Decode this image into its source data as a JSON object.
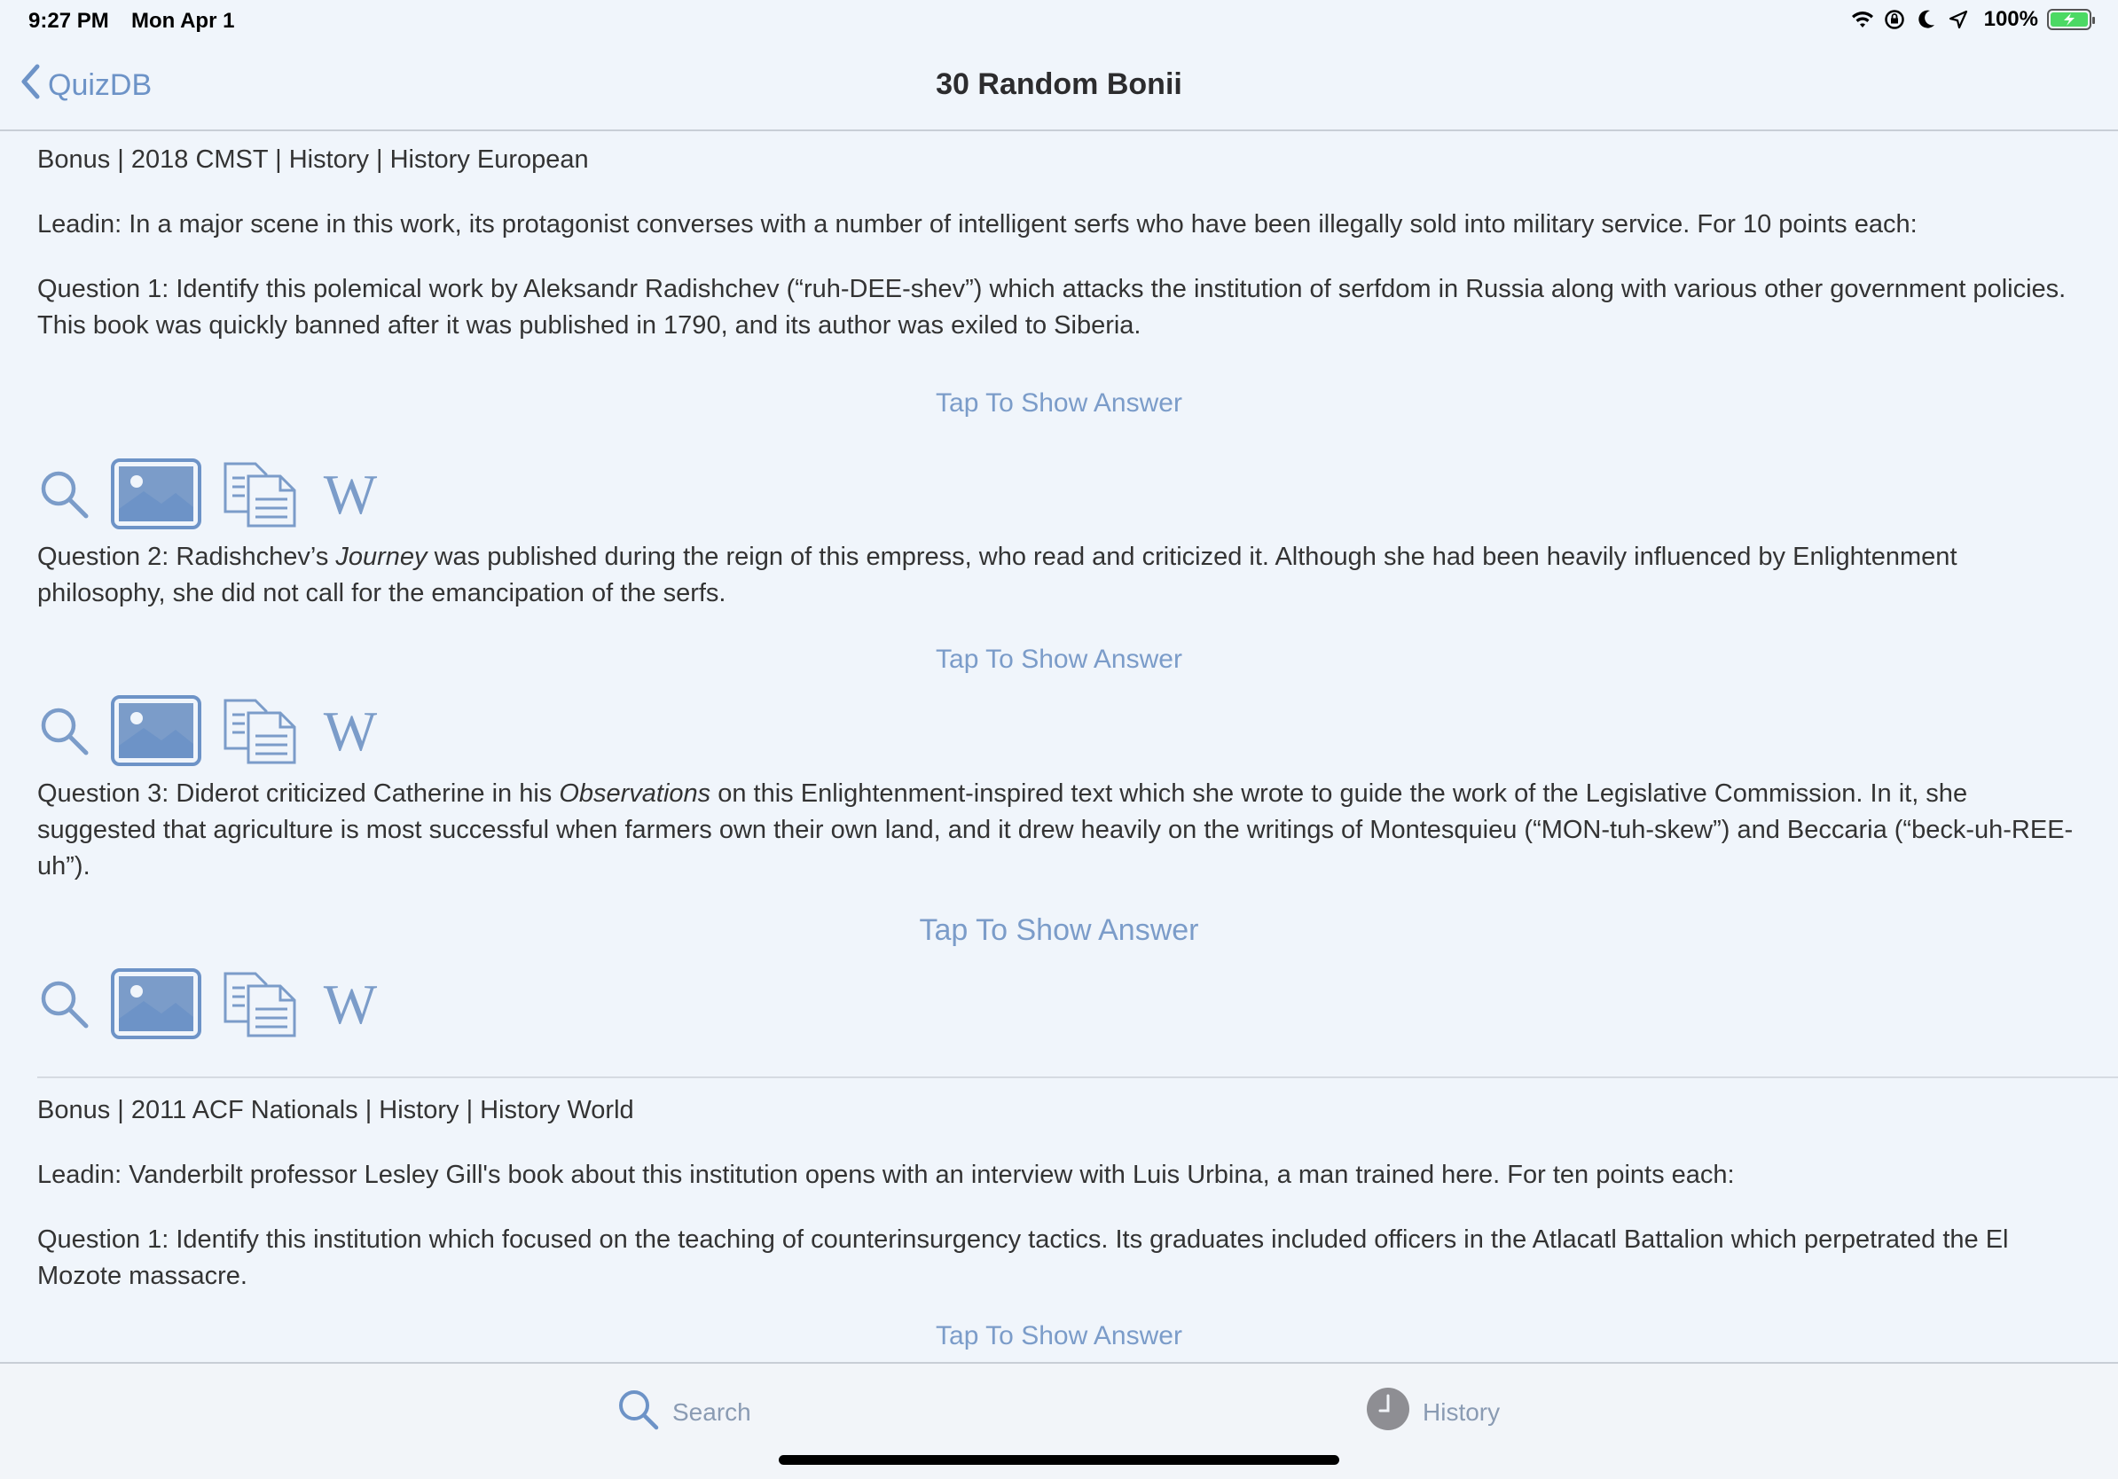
{
  "status_bar": {
    "time": "9:27 PM",
    "date": "Mon Apr 1",
    "battery": "100%",
    "icons": [
      "wifi-icon",
      "orientation-lock-icon",
      "moon-icon",
      "location-icon",
      "battery-charging-icon"
    ]
  },
  "nav": {
    "back_label": "QuizDB",
    "title": "30 Random Bonii"
  },
  "colors": {
    "accent": "#6d93c7",
    "link": "#7b9cc9",
    "background": "#f0f5fb"
  },
  "bonuses": [
    {
      "meta": "Bonus | 2018 CMST | History | History European",
      "leadin": "Leadin: In a major scene in this work, its protagonist converses with a number of intelligent serfs who have been illegally sold into military service. For 10 points each:",
      "questions": [
        {
          "pre": "Question 1: Identify this polemical work by Aleksandr Radishchev (“ruh-DEE-shev”) which attacks the institution of serfdom in Russia along with various other government policies. This book was quickly banned after it was published in 1790, and its author was exiled to Siberia.",
          "italic": "",
          "post": ""
        },
        {
          "pre": "Question 2: Radishchev’s ",
          "italic": "Journey",
          "post": " was published during the reign of this empress, who read and criticized it. Although she had been heavily influenced by Enlightenment philosophy, she did not call for the emancipation of the serfs."
        },
        {
          "pre": "Question 3: Diderot criticized Catherine in his ",
          "italic": "Observations",
          "post": " on this Enlightenment-inspired text which she wrote to guide the work of the Legislative Commission. In it, she suggested that agriculture is most successful when farmers own their own land, and it drew heavily on the writings of Montesquieu (“MON-tuh-skew”) and Beccaria (“beck-uh-REE-uh”)."
        }
      ]
    },
    {
      "meta": "Bonus | 2011 ACF Nationals | History | History World",
      "leadin": "Leadin: Vanderbilt professor Lesley Gill's book about this institution opens with an interview with Luis Urbina, a man trained here. For ten points each:",
      "questions": [
        {
          "pre": "Question 1: Identify this institution which focused on the teaching of counterinsurgency tactics. Its graduates included officers in the Atlacatl Battalion which perpetrated the El Mozote massacre.",
          "italic": "",
          "post": ""
        }
      ]
    }
  ],
  "answer_label": "Tap To Show Answer",
  "action_icons": [
    "search-icon",
    "image-search-icon",
    "documents-icon",
    "wikipedia-icon"
  ],
  "tabs": [
    {
      "label": "Search",
      "icon": "search-icon"
    },
    {
      "label": "History",
      "icon": "clock-icon"
    }
  ]
}
